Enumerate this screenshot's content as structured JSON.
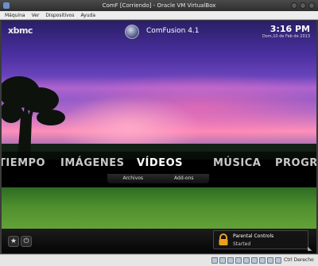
{
  "window": {
    "title": "ComF [Corriendo] - Oracle VM VirtualBox"
  },
  "menubar": {
    "items": [
      "Máquina",
      "Ver",
      "Dispositivos",
      "Ayuda"
    ]
  },
  "xbmc": {
    "logo": "xbmc",
    "skin_name": "ComFusion 4.1",
    "clock": "3:16 PM",
    "date": "Dom,10 de Feb de 2013"
  },
  "home_menu": {
    "items": [
      "TIEMPO",
      "IMÁGENES",
      "VÍDEOS",
      "MÚSICA",
      "PROGRA"
    ],
    "active_index": 2,
    "submenu": [
      "Archivos",
      "Add-ons"
    ]
  },
  "bottom": {
    "favourites_icon": "star-icon",
    "power_icon": "power-icon",
    "notification": {
      "title": "Parental Controls",
      "subtitle": "Started",
      "icon": "lock-icon"
    }
  },
  "statusbar": {
    "host_key": "Ctrl Derecho"
  },
  "colors": {
    "accent_notification_lock": "#e8a020"
  }
}
